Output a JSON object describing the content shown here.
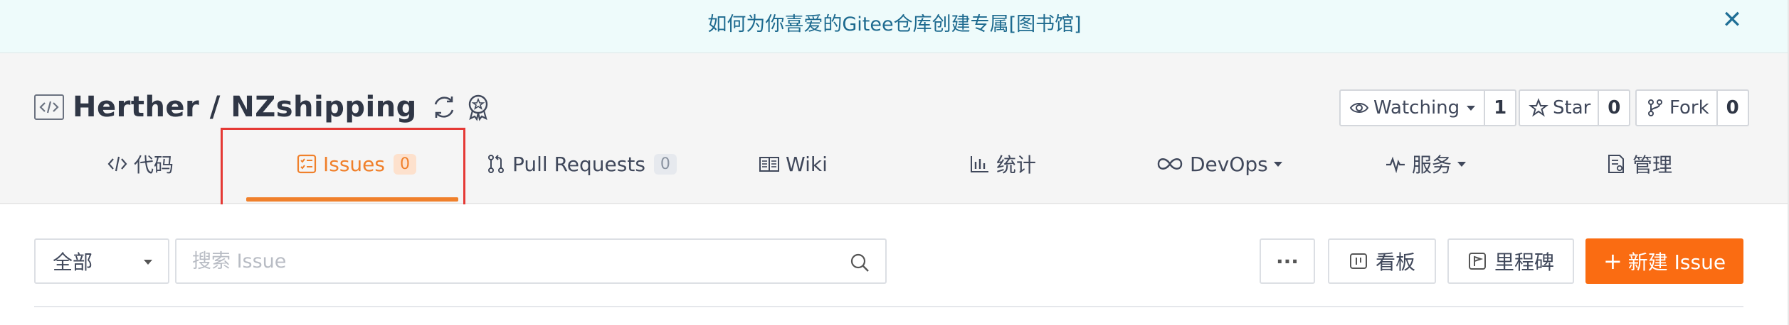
{
  "announcement": {
    "text": "如何为你喜爱的Gitee仓库创建专属[图书馆]",
    "close_icon": "close-icon"
  },
  "repo": {
    "title": "Herther / NZshipping",
    "icons": [
      "code-repo-icon",
      "sync-icon",
      "recommend-badge-icon"
    ]
  },
  "actions": {
    "watching": {
      "label": "Watching",
      "count": "1"
    },
    "star": {
      "label": "Star",
      "count": "0"
    },
    "fork": {
      "label": "Fork",
      "count": "0"
    }
  },
  "tabs": [
    {
      "label": "代码",
      "icon": "code-icon"
    },
    {
      "label": "Issues",
      "badge": "0",
      "icon": "issues-icon",
      "active": true
    },
    {
      "label": "Pull Requests",
      "badge": "0",
      "icon": "pull-request-icon"
    },
    {
      "label": "Wiki",
      "icon": "wiki-icon"
    },
    {
      "label": "统计",
      "icon": "chart-icon"
    },
    {
      "label": "DevOps",
      "icon": "infinity-icon"
    },
    {
      "label": "服务",
      "icon": "pulse-icon"
    },
    {
      "label": "管理",
      "icon": "manage-icon"
    }
  ],
  "toolbar": {
    "filter_value": "全部",
    "search_placeholder": "搜索 Issue",
    "more_label": "···",
    "board_label": "看板",
    "milestone_label": "里程碑",
    "new_issue_label": "新建 Issue"
  },
  "colors": {
    "accent": "#f0802b",
    "new_button": "#fa6c12",
    "highlight": "#e53935"
  }
}
